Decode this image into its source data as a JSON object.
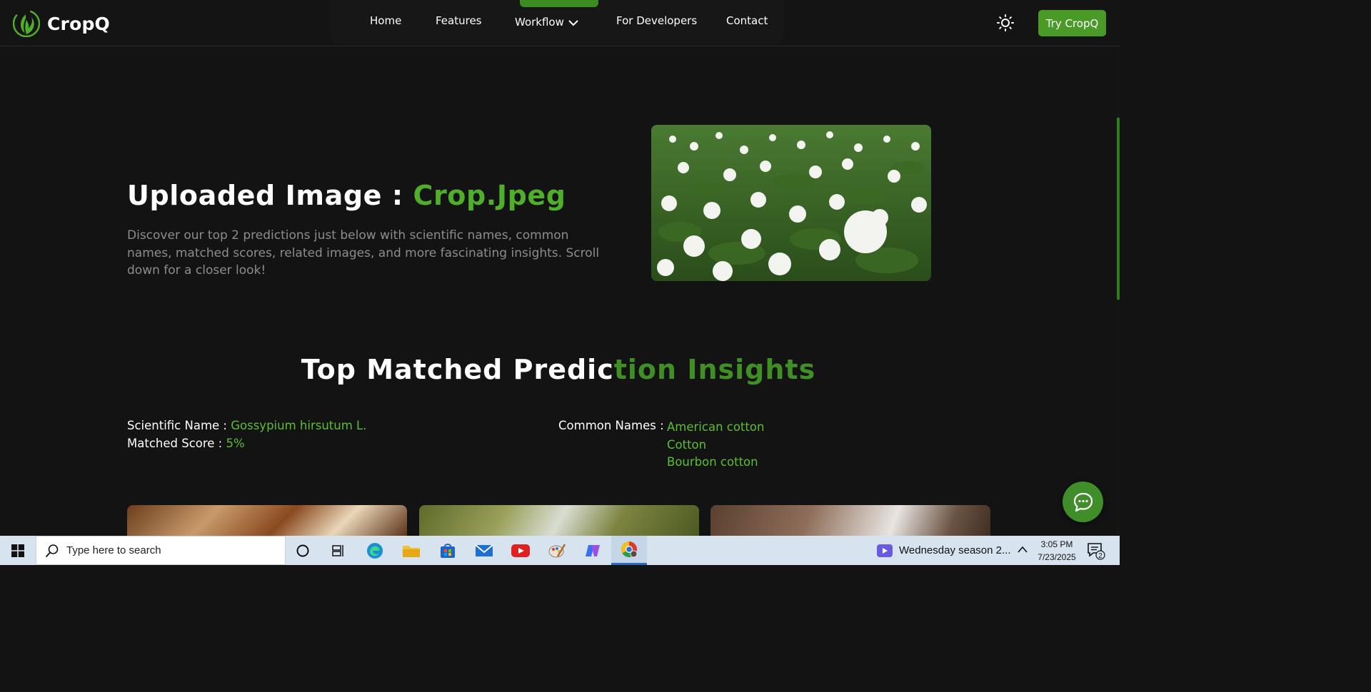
{
  "brand": {
    "name": "CropQ",
    "accent_color": "#4fae2a"
  },
  "nav": {
    "links": [
      "Home",
      "Features",
      "Workflow",
      "For Developers",
      "Contact"
    ],
    "active": "Workflow",
    "cta_label": "Try CropQ",
    "theme_icon": "sun-icon"
  },
  "hero": {
    "title_prefix": "Uploaded Image : ",
    "file_name": "Crop.Jpeg",
    "description": "Discover our top 2 predictions just below with scientific names, common names, matched scores, related images, and more fascinating insights. Scroll down for a closer look!",
    "image_subject": "cotton-field-photo"
  },
  "insights": {
    "title_part1": "Top Matched Predic",
    "title_part2": "tion Insights",
    "scientific_label": "Scientific Name : ",
    "scientific_value": "Gossypium hirsutum L.",
    "score_label": "Matched Score : ",
    "score_value": "5%",
    "common_label": "Common Names : ",
    "common_names": [
      "American cotton",
      "Cotton",
      "Bourbon cotton"
    ]
  },
  "taskbar": {
    "search_placeholder": "Type here to search",
    "news_text": "Wednesday season 2...",
    "time": "3:05 PM",
    "date": "7/23/2025",
    "notification_count": "2"
  }
}
